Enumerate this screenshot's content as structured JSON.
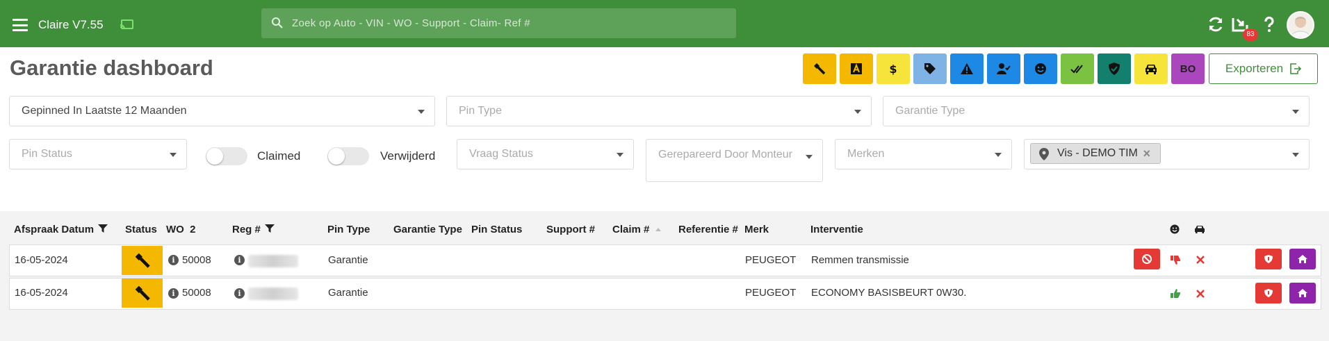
{
  "app": {
    "title": "Claire V7.55",
    "search_placeholder": "Zoek op Auto - VIN - WO - Support - Claim- Ref #",
    "notification_count": "83"
  },
  "page": {
    "title": "Garantie dashboard",
    "export_label": "Exporteren",
    "quick_filters": [
      {
        "icon": "wrench-icon",
        "color": "#f5b800"
      },
      {
        "icon": "letter-a-icon",
        "color": "#f5b800"
      },
      {
        "icon": "dollar-icon",
        "color": "#f7e43a"
      },
      {
        "icon": "tag-icon",
        "color": "#7fb2e5"
      },
      {
        "icon": "warning-icon",
        "color": "#1e88e5"
      },
      {
        "icon": "user-check-icon",
        "color": "#1e88e5"
      },
      {
        "icon": "smiley-icon",
        "color": "#1e88e5"
      },
      {
        "icon": "double-check-icon",
        "color": "#7cc242"
      },
      {
        "icon": "shield-check-icon",
        "color": "#13806e"
      },
      {
        "icon": "car-icon",
        "color": "#f7e43a"
      },
      {
        "icon": "bo-text",
        "color": "#ab47bc",
        "label": "BO"
      }
    ]
  },
  "filters": {
    "period": "Gepinned In Laatste 12 Maanden",
    "pin_type": "Pin Type",
    "garantie_type": "Garantie Type",
    "pin_status": "Pin Status",
    "claimed": "Claimed",
    "verwijderd": "Verwijderd",
    "vraag_status": "Vraag Status",
    "gerepareerd_door": "Gerepareerd Door Monteur",
    "merken": "Merken",
    "location_chip": "Vis - DEMO TIM"
  },
  "table": {
    "headers": {
      "afspraak_datum": "Afspraak Datum",
      "status": "Status",
      "wo": "WO",
      "wo_count": "2",
      "reg": "Reg #",
      "pin_type": "Pin Type",
      "garantie_type": "Garantie Type",
      "pin_status": "Pin Status",
      "support": "Support #",
      "claim": "Claim #",
      "referentie": "Referentie #",
      "merk": "Merk",
      "interventie": "Interventie"
    },
    "rows": [
      {
        "date": "16-05-2024",
        "wo": "50008",
        "pin_type": "Garantie",
        "merk": "PEUGEOT",
        "interventie": "Remmen transmissie",
        "feedback": "thumbs-down"
      },
      {
        "date": "16-05-2024",
        "wo": "50008",
        "pin_type": "Garantie",
        "merk": "PEUGEOT",
        "interventie": "ECONOMY BASISBEURT 0W30.",
        "feedback": "thumbs-up"
      }
    ]
  },
  "colors": {
    "topbar": "#3f8f3a",
    "status_wrench": "#f5b800",
    "danger": "#e53935",
    "purple": "#8e24aa"
  }
}
